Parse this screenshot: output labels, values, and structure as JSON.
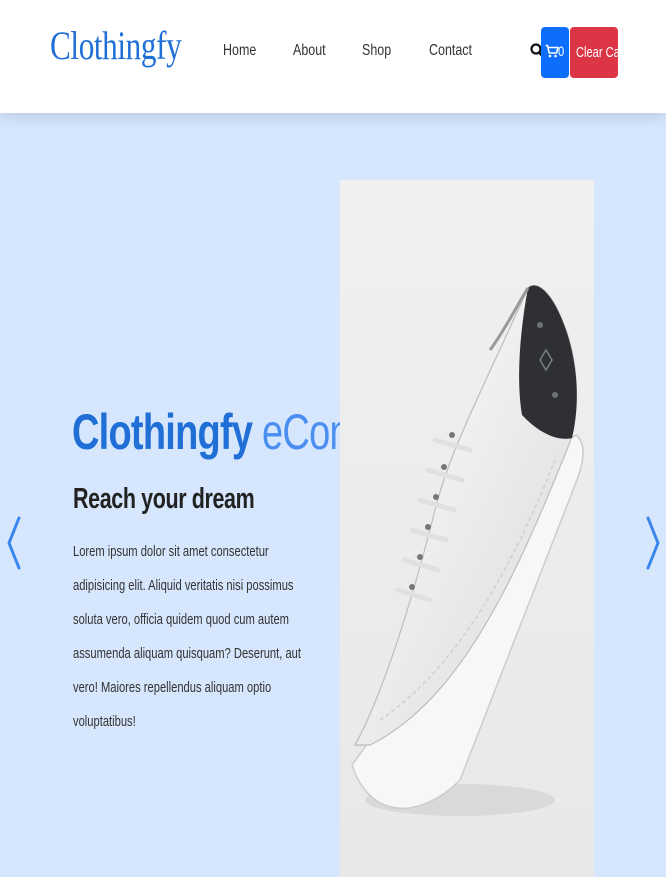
{
  "header": {
    "brand": "Clothingfy",
    "nav": [
      "Home",
      "About",
      "Shop",
      "Contact"
    ],
    "cart_count": "0",
    "clear_cart_label": "Clear Cart"
  },
  "hero": {
    "title_main": "Clothingfy",
    "title_accent": " eCommerce",
    "subtitle": "Reach your dream",
    "body": "Lorem ipsum dolor sit amet consectetur adipisicing elit. Aliquid veritatis nisi possimus soluta vero, officia quidem quod cum autem assumenda aliquam quisquam? Deserunt, aut vero! Maiores repellendus aliquam optio voluptatibus!"
  },
  "colors": {
    "brand": "#1f6fd6",
    "hero_background": "#d6e6fd",
    "cart_button": "#0d6efd",
    "clear_button": "#dc3545"
  },
  "icons": {
    "search": "search-icon",
    "cart": "cart-icon",
    "carousel_prev": "chevron-left-icon",
    "carousel_next": "chevron-right-icon"
  }
}
